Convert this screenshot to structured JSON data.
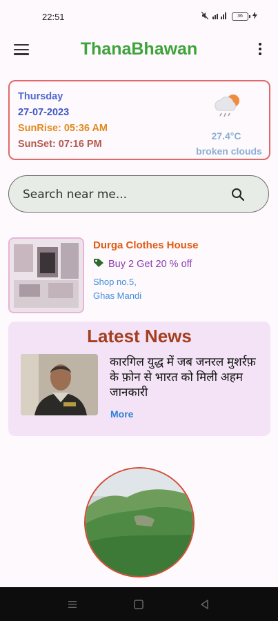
{
  "status_bar": {
    "time": "22:51",
    "battery": "36"
  },
  "app_bar": {
    "title": "ThanaBhawan"
  },
  "weather": {
    "day": "Thursday",
    "date": "27-07-2023",
    "sunrise": "SunRise: 05:36 AM",
    "sunset": "SunSet: 07:16 PM",
    "temperature": "27.4°C",
    "description": "broken clouds",
    "icon": "cloud-rain-sun-icon"
  },
  "search": {
    "placeholder": "Search near me..."
  },
  "shop": {
    "name": "Durga Clothes House",
    "offer": "Buy 2 Get 20 % off",
    "address_line1": "Shop no.5,",
    "address_line2": "Ghas Mandi"
  },
  "news": {
    "heading": "Latest News",
    "title": "कारगिल युद्ध में जब जनरल मुशर्रफ़ के फ़ोन से भारत को मिली अहम जानकारी",
    "more_label": "More"
  },
  "colors": {
    "brand_green": "#3fa33b",
    "card_border": "#e06a6a",
    "news_bg": "#f4e3f6",
    "shop_name": "#e25a12",
    "link_blue": "#2f7fd6"
  }
}
